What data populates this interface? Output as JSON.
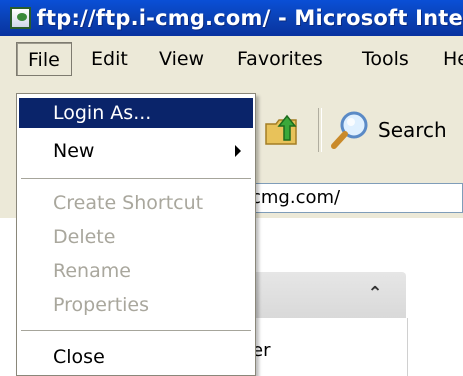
{
  "window": {
    "title": "ftp://ftp.i-cmg.com/ - Microsoft Inte"
  },
  "menubar": {
    "items": [
      {
        "label": "File"
      },
      {
        "label": "Edit"
      },
      {
        "label": "View"
      },
      {
        "label": "Favorites"
      },
      {
        "label": "Tools"
      },
      {
        "label": "He"
      }
    ]
  },
  "file_menu": {
    "items": [
      {
        "label": "Login As...",
        "state": "highlighted"
      },
      {
        "label": "New",
        "state": "submenu"
      },
      {
        "label": "Create Shortcut",
        "state": "disabled"
      },
      {
        "label": "Delete",
        "state": "disabled"
      },
      {
        "label": "Rename",
        "state": "disabled"
      },
      {
        "label": "Properties",
        "state": "disabled"
      },
      {
        "label": "Close",
        "state": "enabled"
      }
    ]
  },
  "toolbar": {
    "search_label": "Search"
  },
  "address": {
    "value": "cmg.com/"
  },
  "panel": {
    "partial_text": "er"
  },
  "colors": {
    "titlebar": "#0a3fb0",
    "menu_highlight": "#0a246a",
    "chrome": "#ece9d8"
  }
}
